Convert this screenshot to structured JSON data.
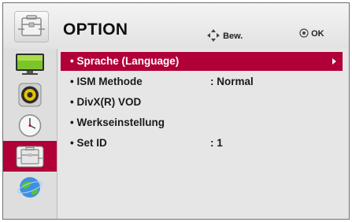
{
  "header": {
    "title": "OPTION",
    "hint_move": "Bew.",
    "hint_ok": "OK"
  },
  "colors": {
    "accent": "#b00037",
    "panel": "#e6e6e6",
    "sidebar": "#dedede"
  },
  "sidebar": {
    "items": [
      {
        "icon": "picture-tv-icon",
        "selected": false
      },
      {
        "icon": "audio-speaker-icon",
        "selected": false
      },
      {
        "icon": "time-clock-icon",
        "selected": false
      },
      {
        "icon": "option-toolbox-icon",
        "selected": true
      },
      {
        "icon": "network-globe-icon",
        "selected": false
      }
    ]
  },
  "menu": {
    "items": [
      {
        "label": "• Sprache (Language)",
        "value": "",
        "selected": true
      },
      {
        "label": "• ISM Methode",
        "value": ": Normal",
        "selected": false
      },
      {
        "label": "• DivX(R) VOD",
        "value": "",
        "selected": false
      },
      {
        "label": "• Werkseinstellung",
        "value": "",
        "selected": false
      },
      {
        "label": "• Set ID",
        "value": ": 1",
        "selected": false
      }
    ]
  }
}
